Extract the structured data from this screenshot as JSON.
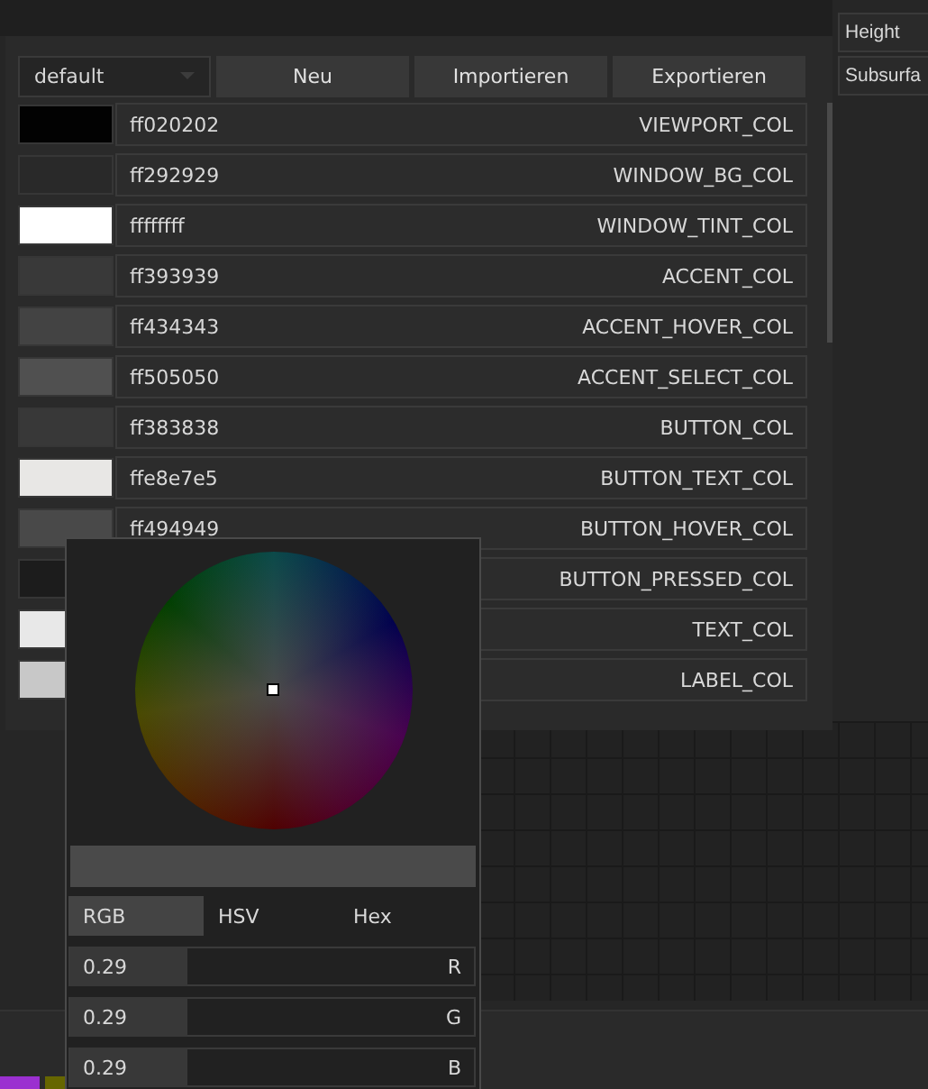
{
  "toolbar": {
    "preset": "default",
    "buttons": [
      "Neu",
      "Importieren",
      "Exportieren"
    ]
  },
  "colors": [
    {
      "hex": "ff020202",
      "name": "VIEWPORT_COL",
      "color": "#020202"
    },
    {
      "hex": "ff292929",
      "name": "WINDOW_BG_COL",
      "color": "#292929"
    },
    {
      "hex": "ffffffff",
      "name": "WINDOW_TINT_COL",
      "color": "#ffffff"
    },
    {
      "hex": "ff393939",
      "name": "ACCENT_COL",
      "color": "#393939"
    },
    {
      "hex": "ff434343",
      "name": "ACCENT_HOVER_COL",
      "color": "#434343"
    },
    {
      "hex": "ff505050",
      "name": "ACCENT_SELECT_COL",
      "color": "#505050"
    },
    {
      "hex": "ff383838",
      "name": "BUTTON_COL",
      "color": "#383838"
    },
    {
      "hex": "ffe8e7e5",
      "name": "BUTTON_TEXT_COL",
      "color": "#e8e7e5"
    },
    {
      "hex": "ff494949",
      "name": "BUTTON_HOVER_COL",
      "color": "#494949"
    },
    {
      "name": "BUTTON_PRESSED_COL",
      "color": "#1c1c1c"
    },
    {
      "name": "TEXT_COL",
      "color": "#e8e8e8"
    },
    {
      "name": "LABEL_COL",
      "color": "#c8c8c8"
    }
  ],
  "side_fields": [
    "Height",
    "Subsurfa"
  ],
  "picker": {
    "tabs": [
      {
        "label": "RGB",
        "selected": true
      },
      {
        "label": "HSV",
        "selected": false
      },
      {
        "label": "Hex",
        "selected": false
      }
    ],
    "channels": [
      {
        "value": "0.29",
        "label": "R",
        "level": 0.29
      },
      {
        "value": "0.29",
        "label": "G",
        "level": 0.29
      },
      {
        "value": "0.29",
        "label": "B",
        "level": 0.29
      }
    ]
  }
}
